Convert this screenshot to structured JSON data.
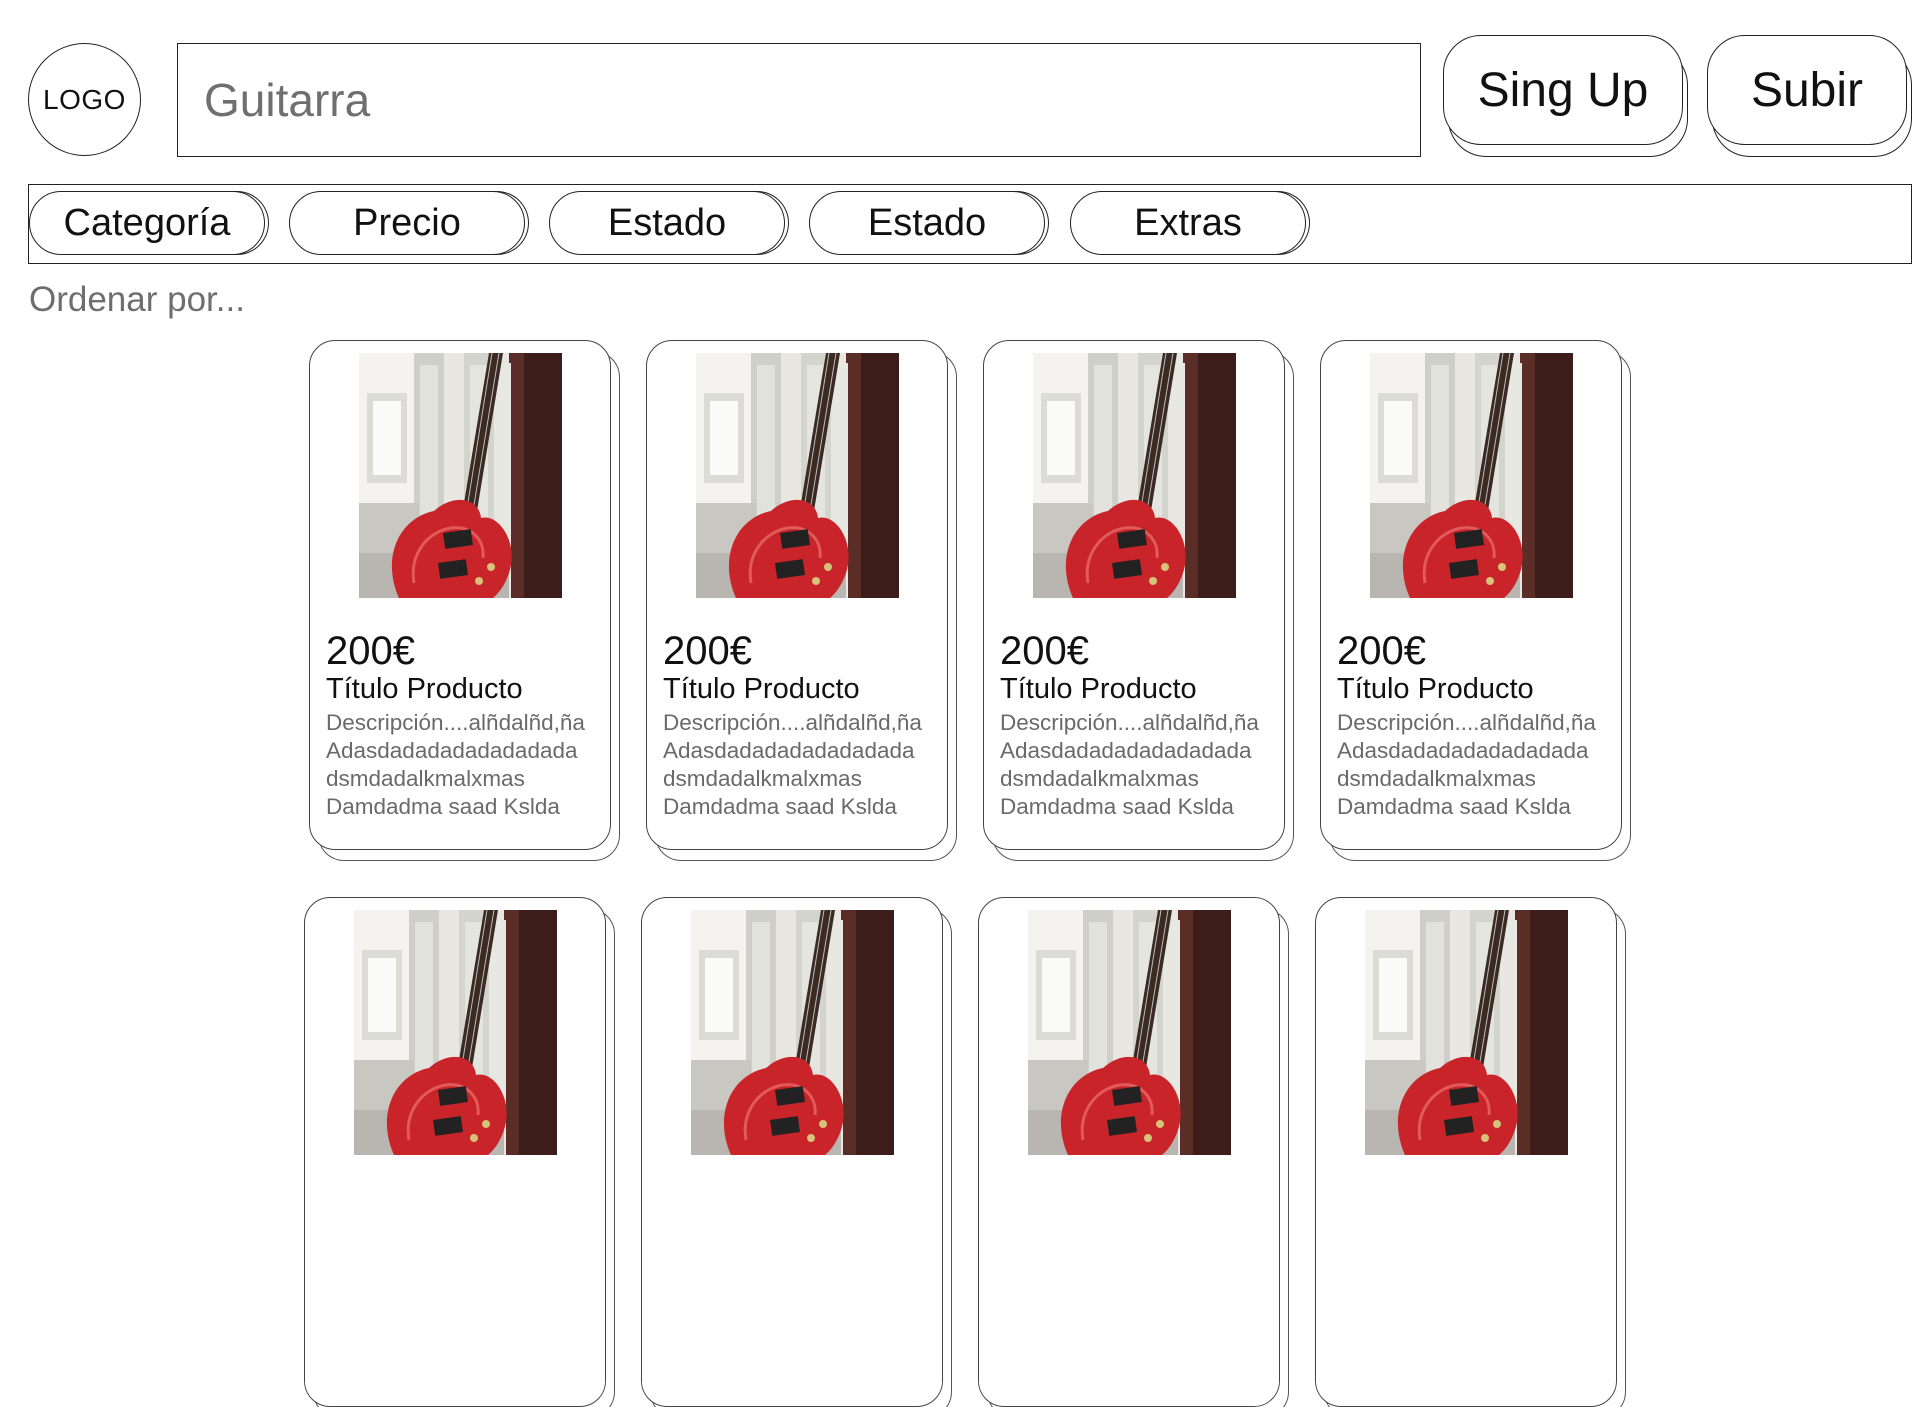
{
  "header": {
    "logo_text": "LOGO",
    "search_value": "",
    "search_placeholder": "Guitarra",
    "signup_label": "Sing Up",
    "upload_label": "Subir"
  },
  "filters": [
    {
      "label": "Categoría"
    },
    {
      "label": "Precio"
    },
    {
      "label": "Estado"
    },
    {
      "label": "Estado"
    },
    {
      "label": "Extras"
    }
  ],
  "sort_label": "Ordenar por...",
  "products": [
    {
      "price": "200€",
      "title": "Título Producto",
      "description": "Descripción....alñdalñd,ña\nAdasdadadadadadadada\ndsmdadalkmalxmas\nDamdadma saad Kslda",
      "image": "red-electric-guitar-photo"
    },
    {
      "price": "200€",
      "title": "Título Producto",
      "description": "Descripción....alñdalñd,ña\nAdasdadadadadadadada\ndsmdadalkmalxmas\nDamdadma saad Kslda",
      "image": "red-electric-guitar-photo"
    },
    {
      "price": "200€",
      "title": "Título Producto",
      "description": "Descripción....alñdalñd,ña\nAdasdadadadadadadada\ndsmdadalkmalxmas\nDamdadma saad Kslda",
      "image": "red-electric-guitar-photo"
    },
    {
      "price": "200€",
      "title": "Título Producto",
      "description": "Descripción....alñdalñd,ña\nAdasdadadadadadadada\ndsmdadalkmalxmas\nDamdadma saad Kslda",
      "image": "red-electric-guitar-photo"
    },
    {
      "price": "",
      "title": "",
      "description": "",
      "image": "red-electric-guitar-photo"
    },
    {
      "price": "",
      "title": "",
      "description": "",
      "image": "red-electric-guitar-photo"
    },
    {
      "price": "",
      "title": "",
      "description": "",
      "image": "red-electric-guitar-photo"
    },
    {
      "price": "",
      "title": "",
      "description": "",
      "image": "red-electric-guitar-photo"
    }
  ]
}
